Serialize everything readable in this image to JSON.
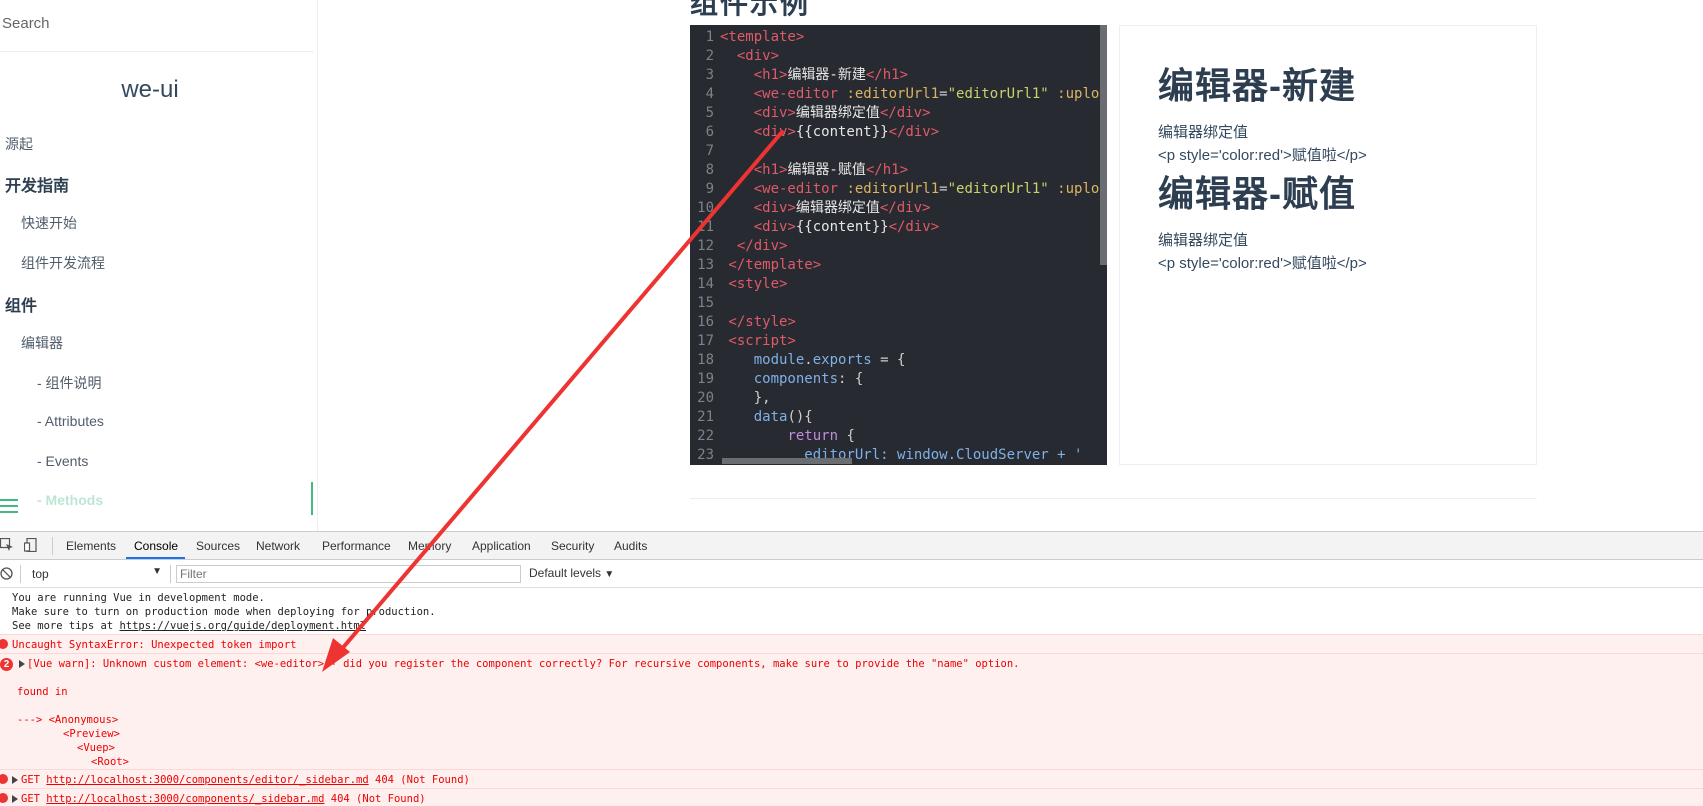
{
  "sidebar": {
    "search_placeholder": "Search",
    "app_name": "we-ui",
    "items": [
      {
        "label": "源起"
      },
      {
        "label": "开发指南"
      },
      {
        "label": "快速开始"
      },
      {
        "label": "组件开发流程"
      },
      {
        "label": "组件"
      },
      {
        "label": "编辑器"
      },
      {
        "label": "- 组件说明"
      },
      {
        "label": "- Attributes"
      },
      {
        "label": "- Events"
      },
      {
        "label": "- Methods"
      }
    ]
  },
  "main": {
    "heading_partial": "组件示例"
  },
  "code_editor": {
    "line_numbers": [
      "1",
      "2",
      "3",
      "4",
      "5",
      "6",
      "7",
      "8",
      "9",
      "10",
      "11",
      "12",
      "13",
      "14",
      "15",
      "16",
      "17",
      "18",
      "19",
      "20",
      "21",
      "22",
      "23"
    ],
    "lines": [
      [
        {
          "t": "tag",
          "v": "<template>"
        }
      ],
      [
        {
          "t": "tag",
          "v": "  <div>"
        }
      ],
      [
        {
          "t": "tag",
          "v": "    <h1>"
        },
        {
          "t": "txt",
          "v": "编辑器-新建"
        },
        {
          "t": "tag",
          "v": "</h1>"
        }
      ],
      [
        {
          "t": "tag",
          "v": "    <we-editor "
        },
        {
          "t": "attr",
          "v": ":editorUrl1"
        },
        {
          "t": "pun",
          "v": "="
        },
        {
          "t": "str",
          "v": "\"editorUrl1\" "
        },
        {
          "t": "attr",
          "v": ":uplo"
        }
      ],
      [
        {
          "t": "tag",
          "v": "    <div>"
        },
        {
          "t": "txt",
          "v": "编辑器绑定值"
        },
        {
          "t": "tag",
          "v": "</div>"
        }
      ],
      [
        {
          "t": "tag",
          "v": "    <div>"
        },
        {
          "t": "txt",
          "v": "{{content}}"
        },
        {
          "t": "tag",
          "v": "</div>"
        }
      ],
      [],
      [
        {
          "t": "tag",
          "v": "    <h1>"
        },
        {
          "t": "txt",
          "v": "编辑器-赋值"
        },
        {
          "t": "tag",
          "v": "</h1>"
        }
      ],
      [
        {
          "t": "tag",
          "v": "    <we-editor "
        },
        {
          "t": "attr",
          "v": ":editorUrl1"
        },
        {
          "t": "pun",
          "v": "="
        },
        {
          "t": "str",
          "v": "\"editorUrl1\" "
        },
        {
          "t": "attr",
          "v": ":uplo"
        }
      ],
      [
        {
          "t": "tag",
          "v": "    <div>"
        },
        {
          "t": "txt",
          "v": "编辑器绑定值"
        },
        {
          "t": "tag",
          "v": "</div>"
        }
      ],
      [
        {
          "t": "tag",
          "v": "    <div>"
        },
        {
          "t": "txt",
          "v": "{{content}}"
        },
        {
          "t": "tag",
          "v": "</div>"
        }
      ],
      [
        {
          "t": "tag",
          "v": "  </div>"
        }
      ],
      [
        {
          "t": "tag",
          "v": " </template>"
        }
      ],
      [
        {
          "t": "tag",
          "v": " <style>"
        }
      ],
      [],
      [
        {
          "t": "tag",
          "v": " </style>"
        }
      ],
      [
        {
          "t": "tag",
          "v": " <script>"
        }
      ],
      [
        {
          "t": "txt",
          "v": "    "
        },
        {
          "t": "prop",
          "v": "module"
        },
        {
          "t": "pun",
          "v": "."
        },
        {
          "t": "prop",
          "v": "exports"
        },
        {
          "t": "pun",
          "v": " = {"
        }
      ],
      [
        {
          "t": "txt",
          "v": "    "
        },
        {
          "t": "prop",
          "v": "components"
        },
        {
          "t": "pun",
          "v": ": {"
        }
      ],
      [
        {
          "t": "pun",
          "v": "    },"
        }
      ],
      [
        {
          "t": "txt",
          "v": "    "
        },
        {
          "t": "prop",
          "v": "data"
        },
        {
          "t": "pun",
          "v": "(){"
        }
      ],
      [
        {
          "t": "txt",
          "v": "        "
        },
        {
          "t": "key",
          "v": "return"
        },
        {
          "t": "pun",
          "v": " {"
        }
      ],
      [
        {
          "t": "txt",
          "v": "          "
        },
        {
          "t": "prop",
          "v": "editorUrl: window.CloudServer + '"
        }
      ]
    ]
  },
  "preview": {
    "h1_new": "编辑器-新建",
    "bind_label_1": "编辑器绑定值",
    "content_1": "<p style='color:red'>赋值啦</p>",
    "h1_assign": "编辑器-赋值",
    "bind_label_2": "编辑器绑定值",
    "content_2": "<p style='color:red'>赋值啦</p>"
  },
  "devtools": {
    "tabs": [
      "Elements",
      "Console",
      "Sources",
      "Network",
      "Performance",
      "Memory",
      "Application",
      "Security",
      "Audits"
    ],
    "active_tab": "Console",
    "context": "top",
    "filter_placeholder": "Filter",
    "levels_label": "Default levels",
    "messages": {
      "info_1": "You are running Vue in development mode.",
      "info_2": "Make sure to turn on production mode when deploying for production.",
      "info_3_prefix": "See more tips at ",
      "info_3_link": "https://vuejs.org/guide/deployment.html",
      "error_1": "Uncaught SyntaxError: Unexpected token import",
      "warn_count": "2",
      "warn_1": "[Vue warn]: Unknown custom element: <we-editor> - did you register the component correctly? For recursive components, make sure to provide the \"name\" option.",
      "warn_found": "found in",
      "warn_trace_1": "---> <Anonymous>",
      "warn_trace_2": "<Preview>",
      "warn_trace_3": "<Vuep>",
      "warn_trace_4": "<Root>",
      "get_1_prefix": "GET ",
      "get_1_url": "http://localhost:3000/components/editor/_sidebar.md",
      "get_1_status": " 404 (Not Found)",
      "get_2_prefix": "GET ",
      "get_2_url": "http://localhost:3000/components/_sidebar.md",
      "get_2_status": " 404 (Not Found)"
    }
  },
  "colors": {
    "accent": "#42b983",
    "error_text": "#e00000",
    "annotation_arrow": "#ee3333"
  }
}
